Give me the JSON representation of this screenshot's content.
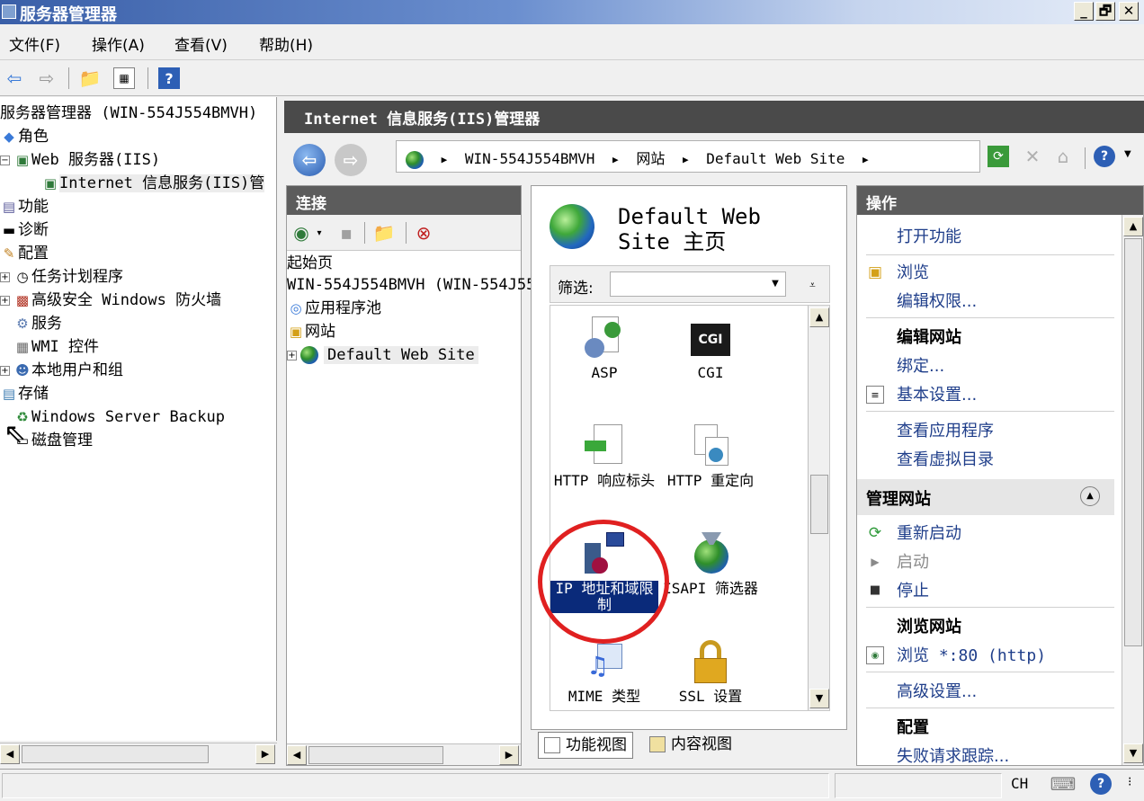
{
  "window": {
    "title": "服务器管理器",
    "controls": [
      "_",
      "🗗",
      "✕"
    ]
  },
  "menu": [
    "文件(F)",
    "操作(A)",
    "查看(V)",
    "帮助(H)"
  ],
  "tree": {
    "root": "服务器管理器 (WIN-554J554BMVH)",
    "roles": "角色",
    "web_server": "Web 服务器(IIS)",
    "iis_manager": "Internet 信息服务(IIS)管",
    "features": "功能",
    "diagnostics": "诊断",
    "configuration": "配置",
    "task_scheduler": "任务计划程序",
    "firewall": "高级安全 Windows 防火墙",
    "services": "服务",
    "wmi": "WMI 控件",
    "local_users": "本地用户和组",
    "storage": "存储",
    "backup": "Windows Server Backup",
    "disk": "磁盘管理"
  },
  "iis": {
    "header": "Internet 信息服务(IIS)管理器"
  },
  "address": {
    "server": "WIN-554J554BMVH",
    "sites": "网站",
    "site": "Default Web Site"
  },
  "connections": {
    "title": "连接",
    "start_page": "起始页",
    "server": "WIN-554J554BMVH (WIN-554J55",
    "app_pools": "应用程序池",
    "sites": "网站",
    "default_site": "Default Web Site"
  },
  "center": {
    "title_line1": "Default Web",
    "title_line2": "Site 主页",
    "filter_label": "筛选:",
    "features": {
      "asp": "ASP",
      "cgi": "CGI",
      "cgi_badge": "CGI",
      "http_headers": "HTTP 响应标头",
      "http_redirect": "HTTP 重定向",
      "ip_restrict": "IP 地址和域限制",
      "isapi": "ISAPI 筛选器",
      "mime": "MIME 类型",
      "ssl": "SSL 设置"
    }
  },
  "views": {
    "feature_view": "功能视图",
    "content_view": "内容视图"
  },
  "actions": {
    "title": "操作",
    "open_feature": "打开功能",
    "browse": "浏览",
    "edit_permissions": "编辑权限...",
    "edit_site": "编辑网站",
    "bindings": "绑定...",
    "basic_settings": "基本设置...",
    "view_apps": "查看应用程序",
    "view_vdirs": "查看虚拟目录",
    "manage_site": "管理网站",
    "restart": "重新启动",
    "start": "启动",
    "stop": "停止",
    "browse_site": "浏览网站",
    "browse_80": "浏览 *:80 (http)",
    "advanced": "高级设置...",
    "config": "配置",
    "failed_tracing": "失败请求跟踪..."
  },
  "status": {
    "lang": "CH"
  }
}
